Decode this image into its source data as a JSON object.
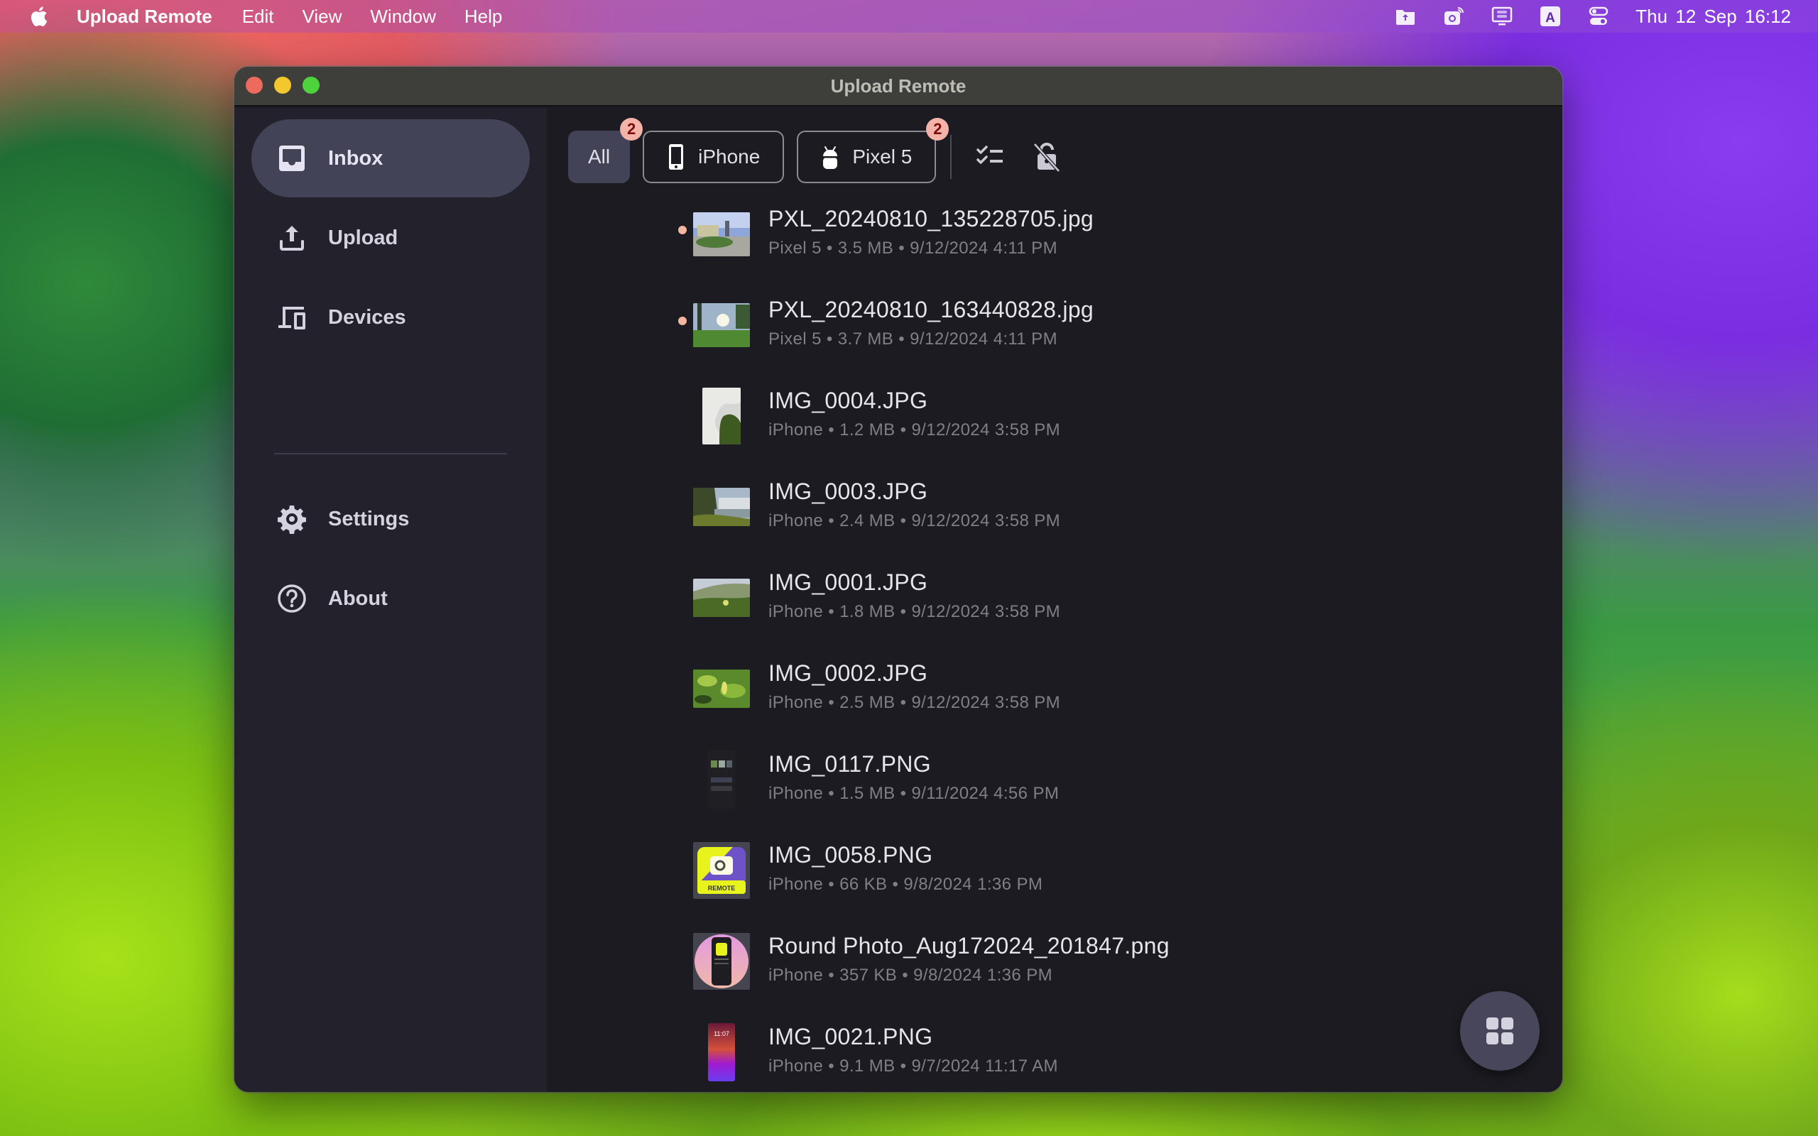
{
  "menubar": {
    "app_name": "Upload Remote",
    "menus": [
      "Edit",
      "View",
      "Window",
      "Help"
    ],
    "status_icons": [
      "upload-folder-icon",
      "remote-camera-icon",
      "display-icon",
      "input-source-icon",
      "control-center-icon"
    ],
    "input_source_letter": "A",
    "clock": "Thu 12 Sep  16:12"
  },
  "window": {
    "title": "Upload Remote"
  },
  "sidebar": {
    "items": [
      {
        "label": "Inbox",
        "icon": "inbox-icon",
        "active": true
      },
      {
        "label": "Upload",
        "icon": "upload-icon",
        "active": false
      },
      {
        "label": "Devices",
        "icon": "devices-icon",
        "active": false
      },
      {
        "label": "Settings",
        "icon": "gear-icon",
        "active": false
      },
      {
        "label": "About",
        "icon": "help-circle-icon",
        "active": false
      }
    ]
  },
  "filters": {
    "chips": [
      {
        "label": "All",
        "badge": "2",
        "active": true
      },
      {
        "label": "iPhone",
        "icon": "iphone-icon",
        "active": false
      },
      {
        "label": "Pixel 5",
        "icon": "android-icon",
        "badge": "2",
        "active": false
      }
    ],
    "tools": [
      "select-list-icon",
      "unlock-off-icon"
    ]
  },
  "files": [
    {
      "name": "PXL_20240810_135228705.jpg",
      "meta": "Pixel 5 • 3.5 MB • 9/12/2024 4:11 PM",
      "unread": true
    },
    {
      "name": "PXL_20240810_163440828.jpg",
      "meta": "Pixel 5 • 3.7 MB • 9/12/2024 4:11 PM",
      "unread": true
    },
    {
      "name": "IMG_0004.JPG",
      "meta": "iPhone • 1.2 MB • 9/12/2024 3:58 PM",
      "unread": false
    },
    {
      "name": "IMG_0003.JPG",
      "meta": "iPhone • 2.4 MB • 9/12/2024 3:58 PM",
      "unread": false
    },
    {
      "name": "IMG_0001.JPG",
      "meta": "iPhone • 1.8 MB • 9/12/2024 3:58 PM",
      "unread": false
    },
    {
      "name": "IMG_0002.JPG",
      "meta": "iPhone • 2.5 MB • 9/12/2024 3:58 PM",
      "unread": false
    },
    {
      "name": "IMG_0117.PNG",
      "meta": "iPhone • 1.5 MB • 9/11/2024 4:56 PM",
      "unread": false
    },
    {
      "name": "IMG_0058.PNG",
      "meta": "iPhone • 66 KB • 9/8/2024 1:36 PM",
      "unread": false
    },
    {
      "name": "Round Photo_Aug172024_201847.png",
      "meta": "iPhone • 357 KB • 9/8/2024 1:36 PM",
      "unread": false
    },
    {
      "name": "IMG_0021.PNG",
      "meta": "iPhone • 9.1 MB • 9/7/2024 11:17 AM",
      "unread": false
    }
  ],
  "thumbnail_labels": {
    "img_0058_caption": "REMOTE",
    "img_0021_time": "11:07"
  },
  "fab": {
    "icon": "grid-view-icon"
  },
  "colors": {
    "unread_dot": "#f6b4a3",
    "badge_bg": "#f3b3a8",
    "badge_text": "#7a0b0b",
    "active_bg": "#434358"
  }
}
